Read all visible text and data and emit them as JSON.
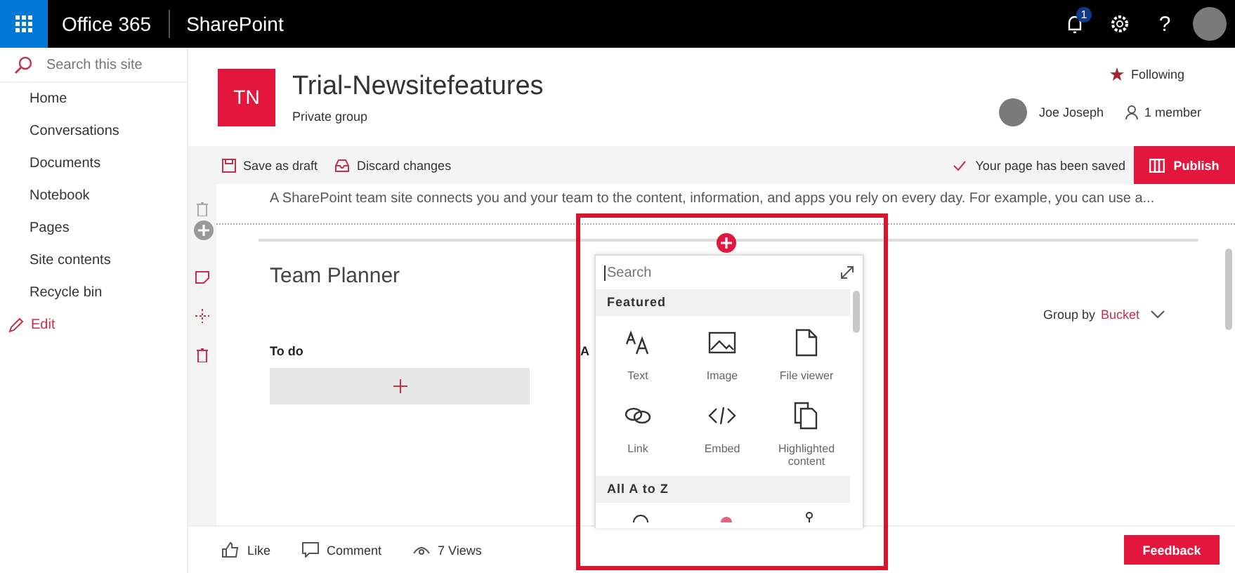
{
  "topbar": {
    "brand": "Office 365",
    "app": "SharePoint",
    "notification_count": "1",
    "help": "?"
  },
  "sidebar": {
    "search": {
      "placeholder": "Search this site"
    },
    "items": [
      {
        "label": "Home"
      },
      {
        "label": "Conversations"
      },
      {
        "label": "Documents"
      },
      {
        "label": "Notebook"
      },
      {
        "label": "Pages"
      },
      {
        "label": "Site contents"
      },
      {
        "label": "Recycle bin"
      }
    ],
    "edit": "Edit"
  },
  "site": {
    "logo": "TN",
    "title": "Trial-Newsitefeatures",
    "subtitle": "Private group",
    "follow": "Following",
    "owner": "Joe Joseph",
    "members": "1 member"
  },
  "command_bar": {
    "save": "Save as draft",
    "discard": "Discard changes",
    "status": "Your page has been saved",
    "publish": "Publish"
  },
  "canvas": {
    "description": "A SharePoint team site connects you and your team to the content, information, and apps you rely on every day. For example, you can use a...",
    "webpart_title": "Team Planner",
    "group_by": "Group by",
    "group_value": "Bucket",
    "columns": [
      {
        "label": "To do"
      },
      {
        "label": "A"
      }
    ]
  },
  "toolbox": {
    "search": {
      "placeholder": "Search"
    },
    "featured": "Featured",
    "items": [
      {
        "kind": "text",
        "label": "Text"
      },
      {
        "kind": "image",
        "label": "Image"
      },
      {
        "kind": "file",
        "label": "File viewer"
      },
      {
        "kind": "link",
        "label": "Link"
      },
      {
        "kind": "embed",
        "label": "Embed"
      },
      {
        "kind": "highlighted",
        "label": "Highlighted content"
      }
    ],
    "all": "All A to Z"
  },
  "footer": {
    "like": "Like",
    "comment": "Comment",
    "views": "7 Views",
    "feedback": "Feedback"
  }
}
